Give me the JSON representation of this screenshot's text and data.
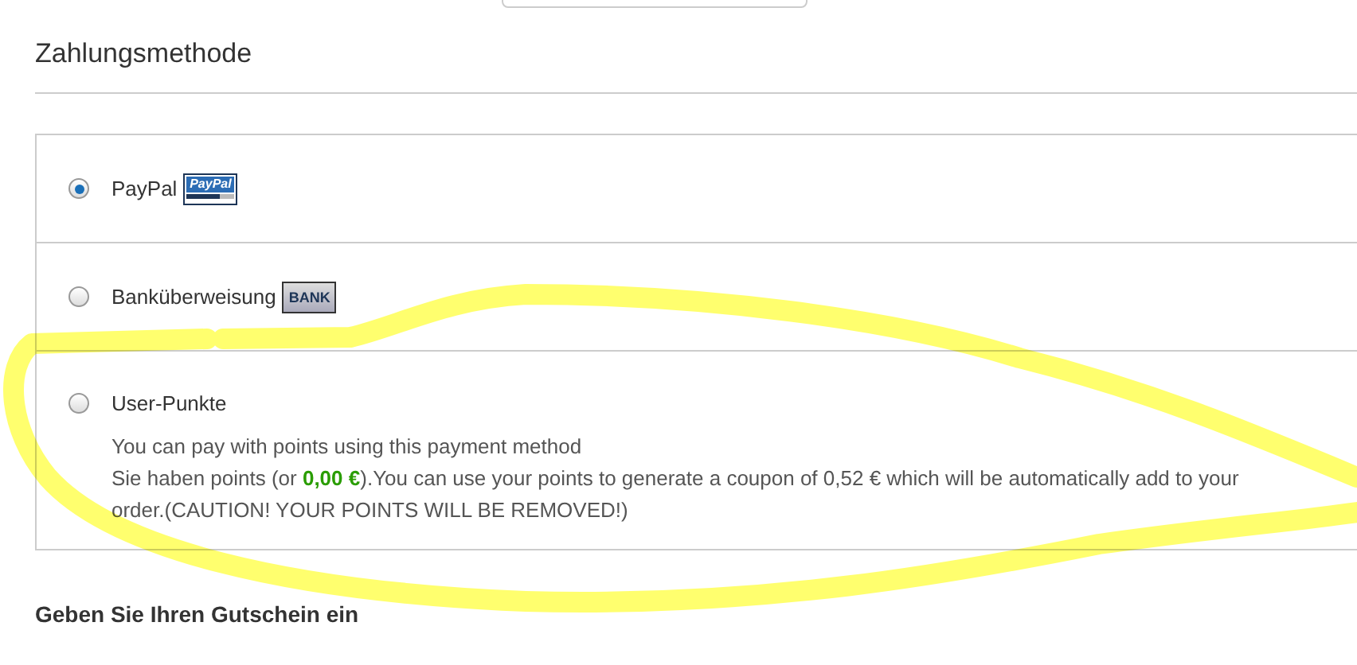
{
  "section_title": "Zahlungsmethode",
  "payment_methods": [
    {
      "label": "PayPal",
      "badge": "PayPal",
      "kind": "paypal",
      "selected": true
    },
    {
      "label": "Banküberweisung",
      "badge": "BANK",
      "kind": "bank",
      "selected": false
    },
    {
      "label": "User-Punkte",
      "kind": "plain",
      "selected": false,
      "description": [
        "You can pay with points using this payment method",
        "Sie haben points (or **0,00 €**).You can use your points to generate a coupon of 0,52 € which will be automatically add to your order.(CAUTION! YOUR POINTS WILL BE REMOVED!)"
      ]
    }
  ],
  "coupon_heading": "Geben Sie Ihren Gutschein ein"
}
